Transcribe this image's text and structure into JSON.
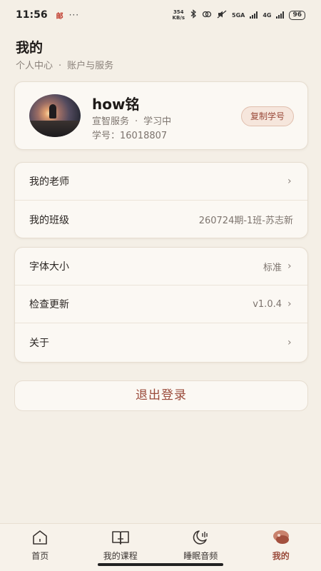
{
  "status_bar": {
    "time": "11:56",
    "notif": "邮",
    "dots": "···",
    "speed_value": "354",
    "speed_unit": "KB/s",
    "net1": "5GA",
    "net2": "4G",
    "battery": "96"
  },
  "header": {
    "title": "我的",
    "subtitle_left": "个人中心",
    "subtitle_sep": "·",
    "subtitle_right": "账户与服务"
  },
  "profile": {
    "name": "how铭",
    "org": "宣智服务",
    "org_sep": "·",
    "status": "学习中",
    "student_id": "学号：16018807",
    "copy_label": "复制学号"
  },
  "study": {
    "teacher_label": "我的老师",
    "class_label": "我的班级",
    "class_value": "260724期-1班-苏志新"
  },
  "settings": {
    "font_label": "字体大小",
    "font_value": "标准",
    "update_label": "检查更新",
    "update_value": "v1.0.4",
    "about_label": "关于"
  },
  "logout_label": "退出登录",
  "tabs": [
    {
      "label": "首页",
      "icon": "home-icon"
    },
    {
      "label": "我的课程",
      "icon": "book-icon"
    },
    {
      "label": "睡眠音频",
      "icon": "moon-icon"
    },
    {
      "label": "我的",
      "icon": "profile-icon"
    }
  ],
  "colors": {
    "background": "#f4efe6",
    "accent": "#9a4a3a"
  }
}
